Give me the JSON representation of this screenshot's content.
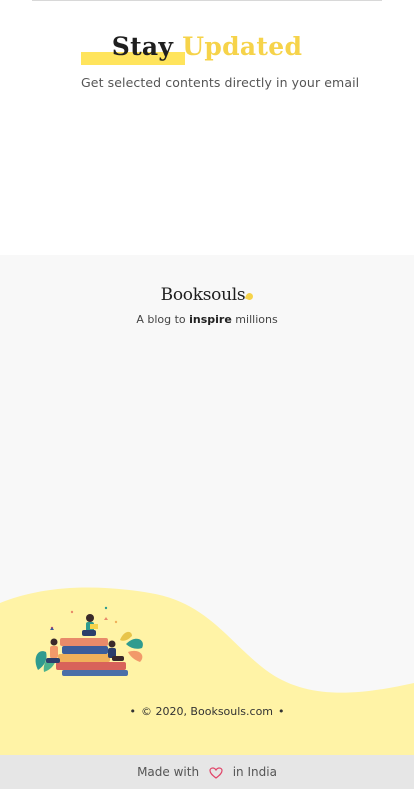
{
  "stay": {
    "title_word1": "Stay",
    "title_word2": "Updated",
    "subtitle": "Get selected contents directly in your email"
  },
  "footer": {
    "brand": "Booksouls",
    "tagline_prefix": "A blog to ",
    "tagline_bold": "inspire",
    "tagline_suffix": " millions",
    "copyright": "© 2020, Booksouls.com",
    "made_prefix": "Made with",
    "made_suffix": "in India"
  },
  "colors": {
    "accent_yellow": "#f6d34a",
    "wave_yellow": "#fff3a6",
    "heart": "#e0466a",
    "footer_bg": "#f8f8f8",
    "bottom_bar": "#e6e6e6"
  },
  "icons": {
    "heart": "heart-icon",
    "illustration": "reading-books-illustration"
  }
}
